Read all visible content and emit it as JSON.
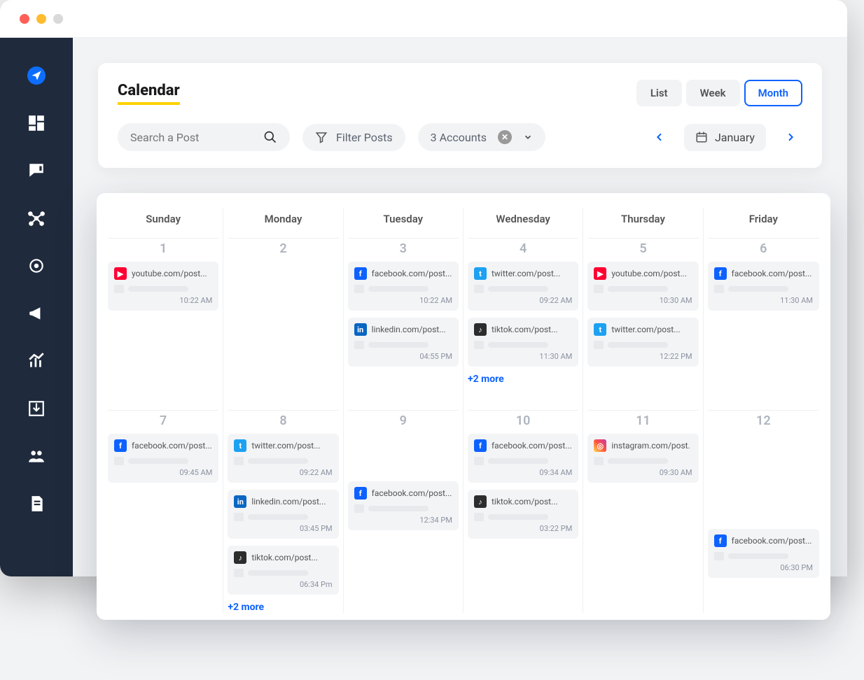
{
  "header": {
    "title": "Calendar"
  },
  "views": {
    "list": "List",
    "week": "Week",
    "month": "Month",
    "active": "month"
  },
  "search": {
    "placeholder": "Search a Post"
  },
  "filter": {
    "label": "Filter Posts"
  },
  "accounts": {
    "label": "3 Accounts"
  },
  "period": {
    "month": "January"
  },
  "days": [
    "Sunday",
    "Monday",
    "Tuesday",
    "Wednesday",
    "Thursday",
    "Friday"
  ],
  "cells": {
    "r1": [
      {
        "num": "1",
        "posts": [
          {
            "net": "yt",
            "url": "youtube.com/post...",
            "time": "10:22 AM"
          }
        ]
      },
      {
        "num": "2",
        "posts": []
      },
      {
        "num": "3",
        "posts": [
          {
            "net": "fb",
            "url": "facebook.com/post...",
            "time": "10:22 AM"
          },
          {
            "net": "li",
            "url": "linkedin.com/post...",
            "time": "04:55 PM"
          }
        ]
      },
      {
        "num": "4",
        "posts": [
          {
            "net": "tw",
            "url": "twitter.com/post...",
            "time": "09:22 AM"
          },
          {
            "net": "tk",
            "url": "tiktok.com/post...",
            "time": "11:30 AM"
          }
        ],
        "more": "+2 more"
      },
      {
        "num": "5",
        "posts": [
          {
            "net": "yt",
            "url": "youtube.com/post...",
            "time": "10:30 AM"
          },
          {
            "net": "tw",
            "url": "twitter.com/post...",
            "time": "12:22 PM"
          }
        ]
      },
      {
        "num": "6",
        "posts": [
          {
            "net": "fb",
            "url": "facebook.com/post...",
            "time": "11:30 AM"
          }
        ]
      }
    ],
    "r2": [
      {
        "num": "7",
        "posts": [
          {
            "net": "fb",
            "url": "facebook.com/post...",
            "time": "09:45 AM"
          }
        ]
      },
      {
        "num": "8",
        "posts": [
          {
            "net": "tw",
            "url": "twitter.com/post...",
            "time": "09:22 AM"
          },
          {
            "net": "li",
            "url": "linkedin.com/post...",
            "time": "03:45 PM"
          },
          {
            "net": "tk",
            "url": "tiktok.com/post...",
            "time": "06:34 Pm"
          }
        ],
        "more": "+2 more"
      },
      {
        "num": "9",
        "posts": [
          {
            "skip": true
          },
          {
            "net": "fb",
            "url": "facebook.com/post...",
            "time": "12:34 PM"
          }
        ]
      },
      {
        "num": "10",
        "posts": [
          {
            "net": "fb",
            "url": "facebook.com/post...",
            "time": "09:34 AM"
          },
          {
            "net": "tk",
            "url": "tiktok.com/post...",
            "time": "03:22 PM"
          }
        ]
      },
      {
        "num": "11",
        "posts": [
          {
            "net": "ig",
            "url": "instagram.com/post.",
            "time": "09:30 AM"
          }
        ]
      },
      {
        "num": "12",
        "posts": [
          {
            "skip": true
          },
          {
            "skip": true
          },
          {
            "net": "fb",
            "url": "facebook.com/post...",
            "time": "06:30 PM"
          }
        ]
      }
    ]
  },
  "iconGlyph": {
    "fb": "f",
    "yt": "▶",
    "tw": "t",
    "li": "in",
    "tk": "♪",
    "ig": "◎"
  }
}
